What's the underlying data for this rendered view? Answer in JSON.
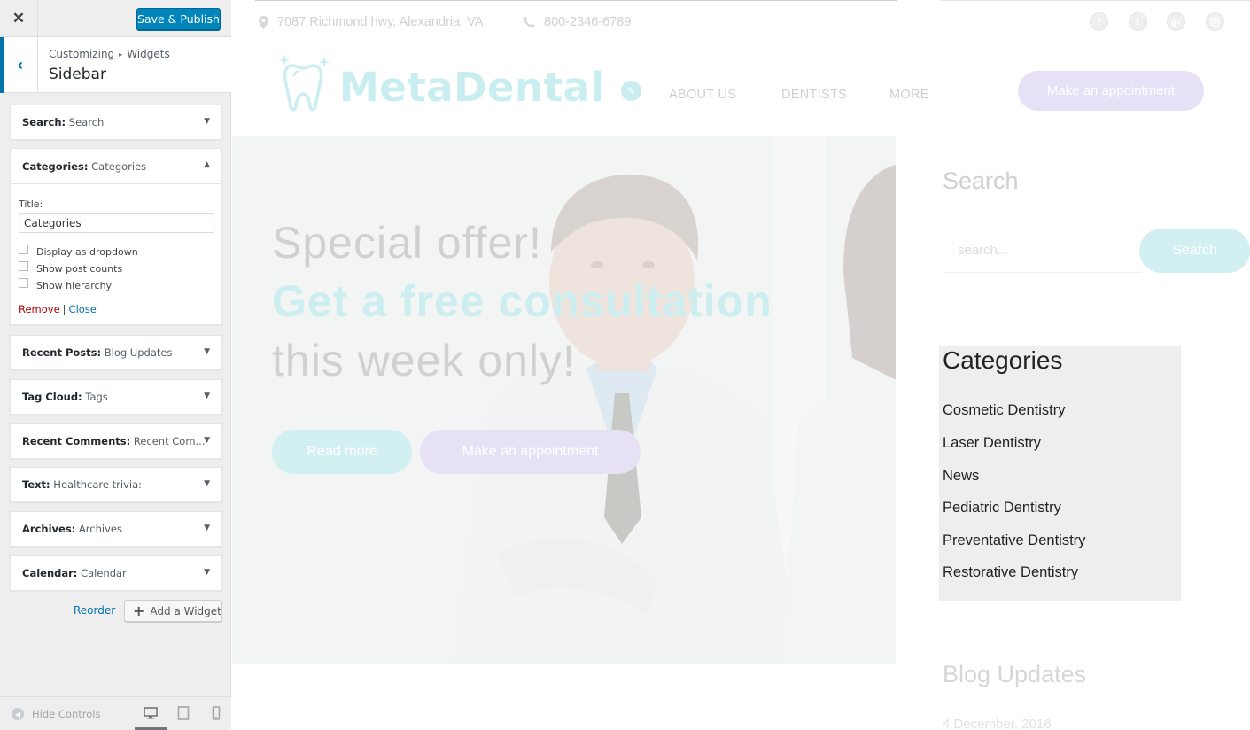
{
  "customizer": {
    "close_icon": "close-icon",
    "save_label": "Save & Publish",
    "breadcrumb": {
      "first": "Customizing",
      "separator": "▸",
      "second": "Widgets"
    },
    "section_title": "Sidebar",
    "widgets": [
      {
        "type": "Search:",
        "title": "Search",
        "expanded": false
      },
      {
        "type": "Categories:",
        "title": "Categories",
        "expanded": true
      },
      {
        "type": "Recent Posts:",
        "title": "Blog Updates",
        "expanded": false
      },
      {
        "type": "Tag Cloud:",
        "title": "Tags",
        "expanded": false
      },
      {
        "type": "Recent Comments:",
        "title": "Recent Com...",
        "expanded": false
      },
      {
        "type": "Text:",
        "title": "Healthcare trivia:",
        "expanded": false
      },
      {
        "type": "Archives:",
        "title": "Archives",
        "expanded": false
      },
      {
        "type": "Calendar:",
        "title": "Calendar",
        "expanded": false
      }
    ],
    "categories_form": {
      "title_label": "Title:",
      "title_value": "Categories",
      "options": [
        {
          "label": "Display as dropdown",
          "checked": false
        },
        {
          "label": "Show post counts",
          "checked": false
        },
        {
          "label": "Show hierarchy",
          "checked": false
        }
      ],
      "remove_label": "Remove",
      "separator": "|",
      "close_label": "Close"
    },
    "reorder_label": "Reorder",
    "add_widget_label": "Add a Widget",
    "hide_controls_label": "Hide Controls",
    "active_device": "desktop",
    "colors": {
      "accent": "#0085ba",
      "link": "#0073aa",
      "remove": "#aa0000"
    }
  },
  "preview": {
    "topbar": {
      "address": "7087 Richmond hwy, Alexandria, VA",
      "phone": "800-2346-6789",
      "social_icons": [
        "facebook-icon",
        "twitter-icon",
        "google-plus-icon",
        "instagram-icon"
      ]
    },
    "logo_text": "MetaDental",
    "nav": [
      "ABOUT US",
      "DENTISTS",
      "MORE"
    ],
    "nav_button": "Make an appointment",
    "hero": {
      "line1": "Special offer!",
      "line2": "Get a free consultation",
      "line3": "this week only!",
      "read_more": "Read more",
      "appointment": "Make an appointment"
    },
    "sidebar": {
      "search_title": "Search",
      "search_placeholder": "search...",
      "search_button": "Search",
      "categories_title": "Categories",
      "categories": [
        "Cosmetic Dentistry",
        "Laser Dentistry",
        "News",
        "Pediatric Dentistry",
        "Preventative Dentistry",
        "Restorative Dentistry"
      ],
      "blog_title": "Blog Updates",
      "blog_date": "4 December, 2016"
    },
    "colors": {
      "brand_teal": "#c9eef0",
      "brand_lavender": "#e6e1f6"
    }
  }
}
